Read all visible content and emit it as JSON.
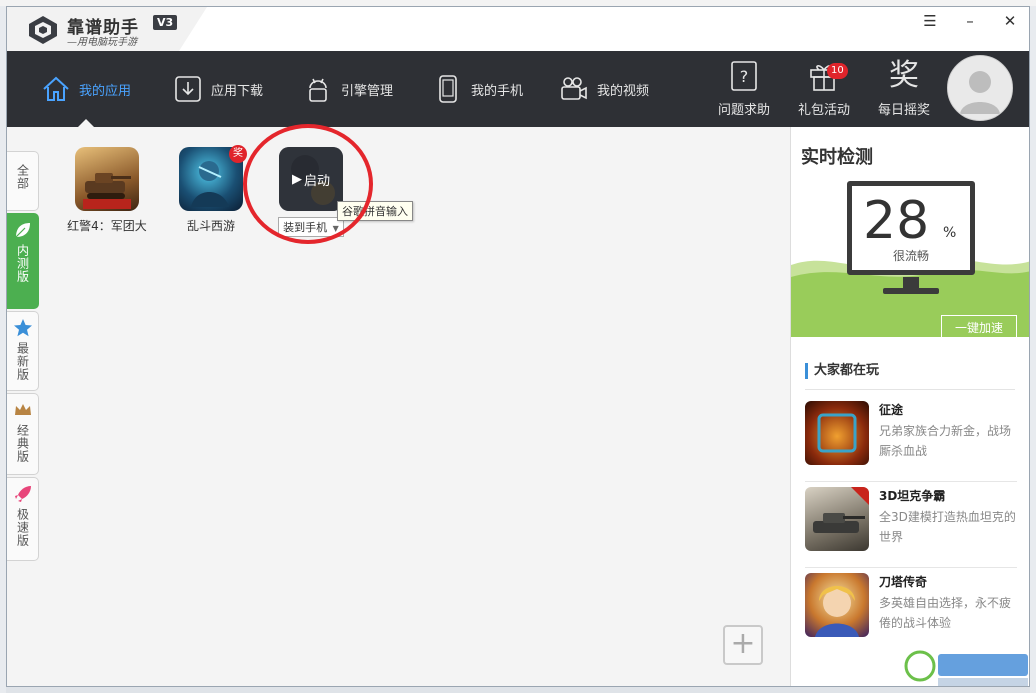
{
  "app": {
    "name": "靠谱助手",
    "version": "V3",
    "slogan": "—用电脑玩手游"
  },
  "window_controls": {
    "menu": "☰",
    "minimize": "–",
    "close": "✕"
  },
  "nav": {
    "items": [
      {
        "label": "我的应用",
        "icon": "home-icon",
        "active": true
      },
      {
        "label": "应用下载",
        "icon": "download-icon"
      },
      {
        "label": "引擎管理",
        "icon": "android-icon"
      },
      {
        "label": "我的手机",
        "icon": "phone-icon"
      },
      {
        "label": "我的视频",
        "icon": "video-camera-icon"
      }
    ],
    "right": [
      {
        "label": "问题求助",
        "icon": "help-icon"
      },
      {
        "label": "礼包活动",
        "icon": "gift-icon",
        "badge": "10"
      },
      {
        "label": "每日摇奖",
        "icon": "reward-icon",
        "glyph": "奖"
      }
    ]
  },
  "side_tabs": [
    {
      "label": "全部"
    },
    {
      "label": "内测版",
      "active": true,
      "icon": "leaf-icon"
    },
    {
      "label": "最新版",
      "icon": "star-icon"
    },
    {
      "label": "经典版",
      "icon": "crown-icon"
    },
    {
      "label": "极速版",
      "icon": "rocket-icon"
    }
  ],
  "apps": [
    {
      "label": "红警4：军团大"
    },
    {
      "label": "乱斗西游",
      "badge": "奖"
    },
    {
      "label": "",
      "overlay": "启动",
      "install_label": "装到手机"
    }
  ],
  "tooltip": "谷歌拼音输入",
  "add_button": "+",
  "monitor": {
    "title": "实时检测",
    "value": "28",
    "unit": "%",
    "status": "很流畅",
    "speedup": "一键加速"
  },
  "popular": {
    "title": "大家都在玩",
    "games": [
      {
        "name": "征途",
        "desc": "兄弟家族合力新金，战场厮杀血战"
      },
      {
        "name": "3D坦克争霸",
        "desc": "全3D建模打造热血坦克的世界"
      },
      {
        "name": "刀塔传奇",
        "desc": "多英雄自由选择，永不疲倦的战斗体验"
      }
    ]
  },
  "colors": {
    "nav_bg": "#2e3035",
    "active_blue": "#4aa3ff",
    "green": "#4caf50",
    "red": "#e4262c"
  }
}
